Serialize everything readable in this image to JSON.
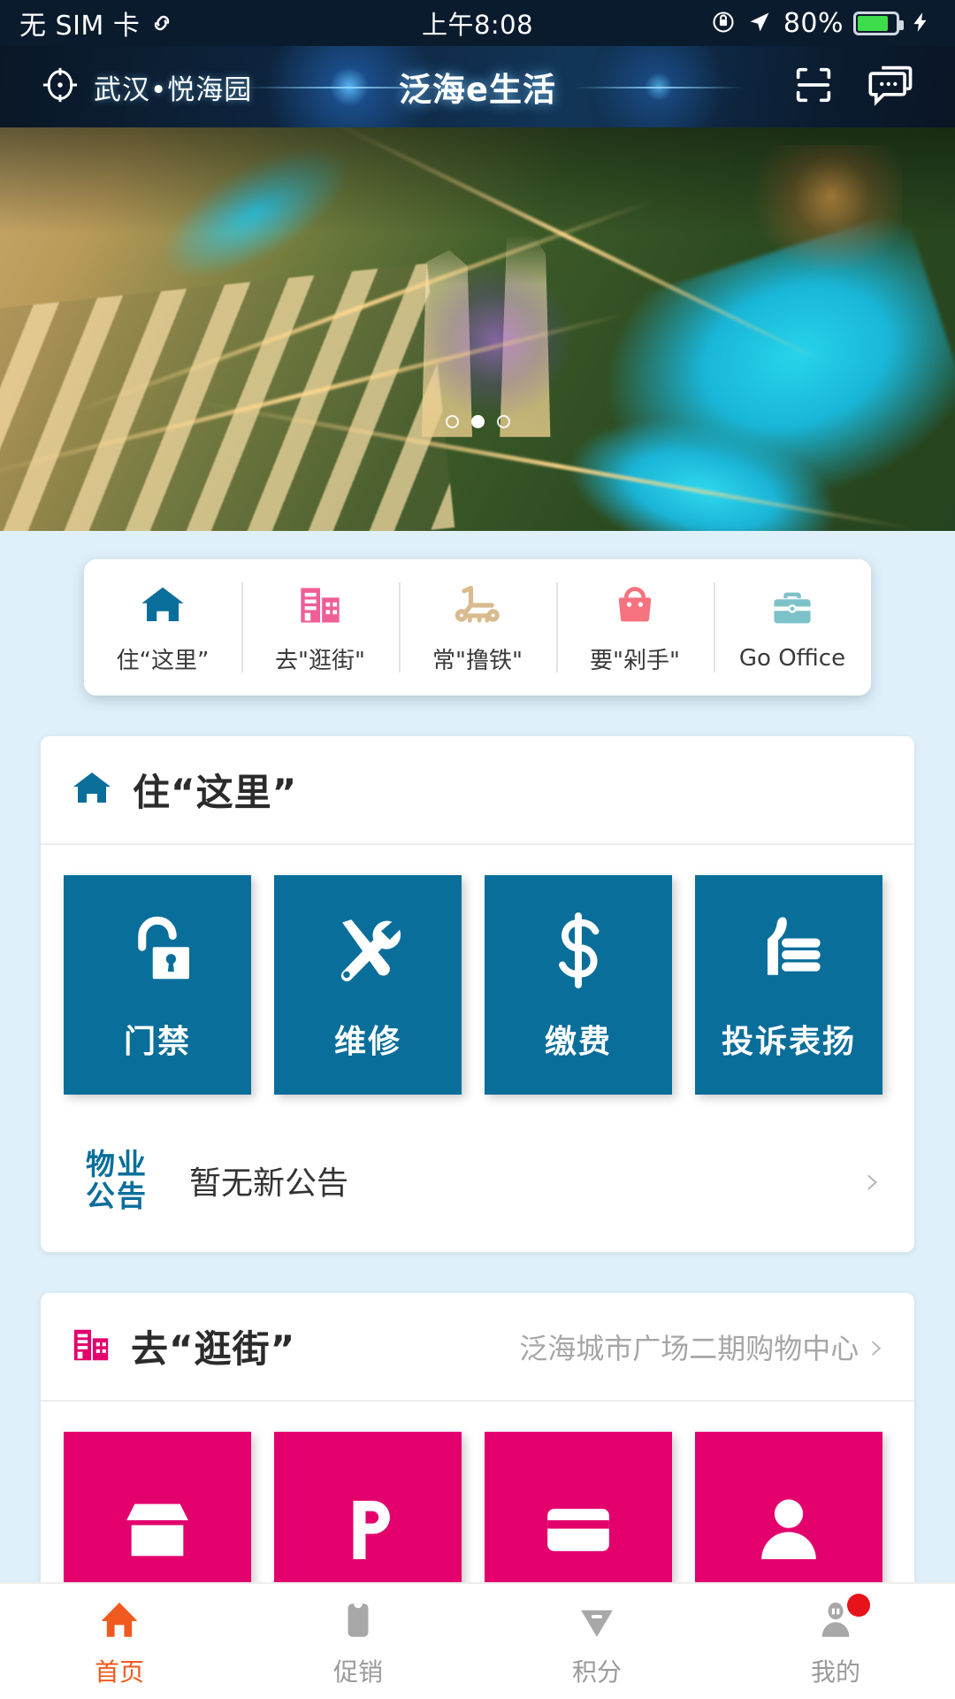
{
  "status_bar": {
    "carrier": "无 SIM 卡",
    "carrier_icon": "sim-link-icon",
    "time": "上午8:08",
    "rotation_lock_icon": "rotation-lock-icon",
    "location_icon": "location-arrow-icon",
    "battery_percent": "80%",
    "battery_level": 80,
    "charging_icon": "charging-bolt-icon"
  },
  "header": {
    "location_icon": "crosshair-target-icon",
    "location_label": "武汉•悦海园",
    "title": "泛海e生活",
    "scan_icon": "scan-qr-icon",
    "chat_icon": "chat-bubble-icon"
  },
  "hero": {
    "image_alt": "aerial-night-cityscape-banner",
    "carousel": {
      "total": 3,
      "active_index": 1
    }
  },
  "quick_nav": {
    "items": [
      {
        "label": "住“这里”",
        "icon": "home-icon",
        "color": "#0a6e9b"
      },
      {
        "label": "去\"逛街\"",
        "icon": "building-icon",
        "color": "#ef5e97"
      },
      {
        "label": "常\"撸铁\"",
        "icon": "treadmill-icon",
        "color": "#d8bb8e"
      },
      {
        "label": "要\"剁手\"",
        "icon": "handbag-icon",
        "color": "#f4737f"
      },
      {
        "label": "Go Office",
        "icon": "briefcase-icon",
        "color": "#7ec2c9"
      }
    ]
  },
  "sections": [
    {
      "id": "live-here",
      "icon": "home-icon",
      "title": "住“这里”",
      "subtitle": "",
      "tile_color": "#0a6e9b",
      "tiles": [
        {
          "label": "门禁",
          "icon": "unlock-padlock-icon"
        },
        {
          "label": "维修",
          "icon": "tools-wrench-screwdriver-icon"
        },
        {
          "label": "缴费",
          "icon": "dollar-sign-icon"
        },
        {
          "label": "投诉表扬",
          "icon": "thumbs-up-icon"
        }
      ],
      "notice": {
        "badge_line1": "物业",
        "badge_line2": "公告",
        "badge_icon": "property-notice-icon",
        "text": "暂无新公告",
        "chevron_icon": "chevron-right-icon"
      }
    },
    {
      "id": "go-shopping",
      "icon": "building-icon",
      "title": "去“逛街”",
      "subtitle": "泛海城市广场二期购物中心",
      "chevron_icon": "chevron-right-icon",
      "tile_color": "#e3006d",
      "tiles": [
        {
          "label": "",
          "icon": "shop-icon"
        },
        {
          "label": "",
          "icon": "parking-p-icon"
        },
        {
          "label": "",
          "icon": "card-icon"
        },
        {
          "label": "",
          "icon": "person-icon"
        }
      ]
    }
  ],
  "tabbar": {
    "items": [
      {
        "label": "首页",
        "icon": "home-icon",
        "active": true,
        "badge": false
      },
      {
        "label": "促销",
        "icon": "tag-sale-icon",
        "active": false,
        "badge": false
      },
      {
        "label": "积分",
        "icon": "diamond-points-icon",
        "active": false,
        "badge": false
      },
      {
        "label": "我的",
        "icon": "user-profile-icon",
        "active": false,
        "badge": true
      }
    ]
  },
  "colors": {
    "brand_blue": "#0a6e9b",
    "brand_pink": "#e3006d",
    "accent_orange": "#f05a1e",
    "page_bg": "#dff0fb",
    "header_dark": "#0b1b2e",
    "badge_red": "#e8131a"
  }
}
